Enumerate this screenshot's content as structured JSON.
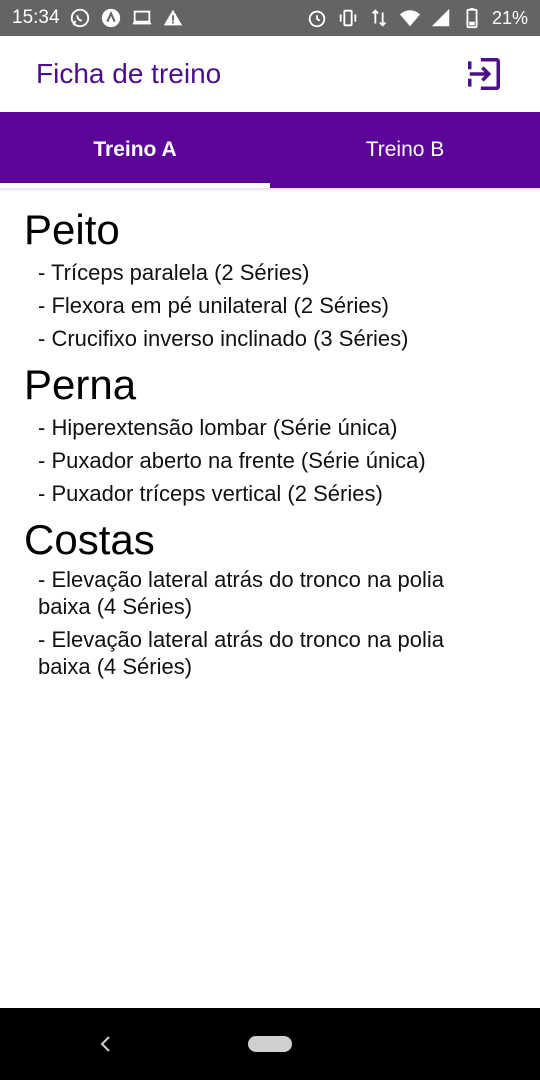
{
  "status_bar": {
    "time": "15:34",
    "battery": "21%",
    "left_icons": [
      "whatsapp-icon",
      "notification-app-icon",
      "laptop-icon",
      "warning-icon"
    ],
    "right_icons": [
      "alarm-icon",
      "vibrate-icon",
      "data-transfer-icon",
      "wifi-icon",
      "signal-icon",
      "battery-icon"
    ]
  },
  "app_bar": {
    "title": "Ficha de treino",
    "action_icon": "exit-icon"
  },
  "tabs": [
    {
      "label": "Treino A",
      "active": true
    },
    {
      "label": "Treino B",
      "active": false
    }
  ],
  "sections": [
    {
      "title": "Peito",
      "exercises": [
        " - Tríceps paralela (2 Séries)",
        " - Flexora em pé unilateral (2 Séries)",
        " - Crucifixo inverso inclinado (3 Séries)"
      ]
    },
    {
      "title": "Perna",
      "exercises": [
        " - Hiperextensão lombar (Série única)",
        " - Puxador aberto na frente (Série única)",
        " - Puxador tríceps vertical (2 Séries)"
      ]
    },
    {
      "title": "Costas",
      "exercises": [
        " - Elevação lateral atrás do tronco na polia baixa (4 Séries)",
        " - Elevação lateral atrás do tronco na polia baixa (4 Séries)"
      ]
    }
  ],
  "colors": {
    "accent": "#5c0699",
    "title": "#4b0f8c",
    "status_bar": "#646464",
    "nav_bar": "#000000"
  }
}
